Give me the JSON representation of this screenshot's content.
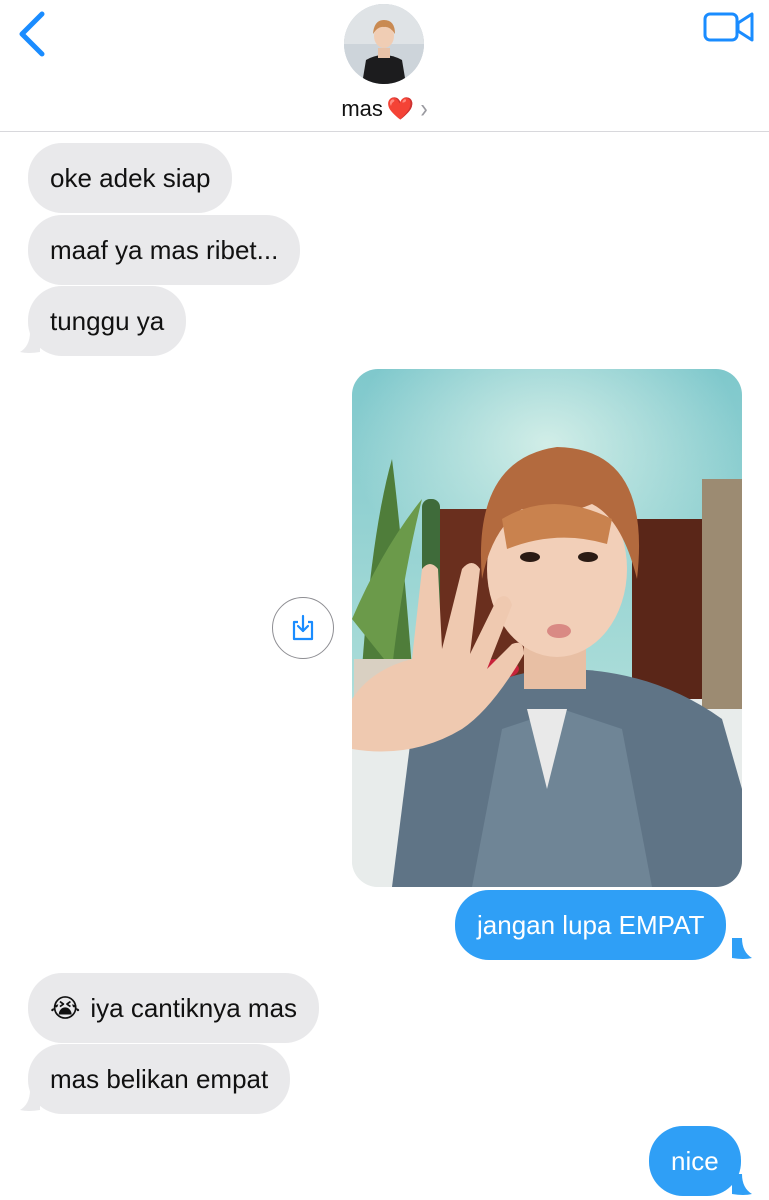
{
  "header": {
    "contact_name": "mas",
    "contact_emoji": "❤️",
    "chevron": "›"
  },
  "icons": {
    "back": "chevron-left-icon",
    "video": "video-camera-icon",
    "save": "save-image-icon"
  },
  "colors": {
    "accent": "#1a8cff",
    "incoming_bubble": "#e9e9eb",
    "outgoing_bubble": "#2f9ff6"
  },
  "messages": [
    {
      "direction": "incoming",
      "text": "oke adek siap"
    },
    {
      "direction": "incoming",
      "text": "maaf ya mas ribet..."
    },
    {
      "direction": "incoming",
      "text": "tunggu ya"
    },
    {
      "direction": "outgoing",
      "type": "image"
    },
    {
      "direction": "outgoing",
      "text": "jangan lupa EMPAT"
    },
    {
      "direction": "incoming",
      "emoji": "😭",
      "text": "iya cantiknya mas"
    },
    {
      "direction": "incoming",
      "text": "mas belikan empat"
    },
    {
      "direction": "outgoing",
      "text": "nice"
    }
  ]
}
